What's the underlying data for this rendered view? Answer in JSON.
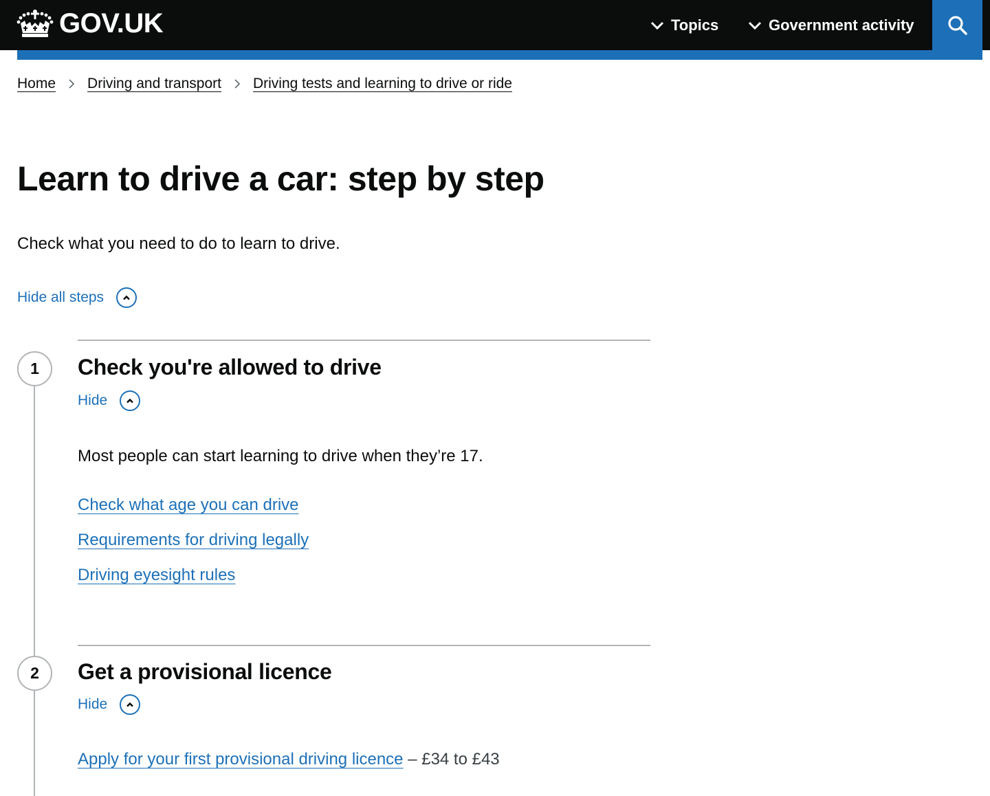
{
  "header": {
    "logo_text": "GOV.UK",
    "nav": [
      {
        "label": "Topics"
      },
      {
        "label": "Government activity"
      }
    ],
    "search_icon": "search-icon"
  },
  "colors": {
    "header_bg": "#0b0c0c",
    "brand_blue": "#1d70b8",
    "text": "#0b0c0c",
    "border": "#b1b4b6"
  },
  "breadcrumb": [
    {
      "label": "Home"
    },
    {
      "label": "Driving and transport"
    },
    {
      "label": "Driving tests and learning to drive or ride"
    }
  ],
  "page": {
    "title": "Learn to drive a car: step by step",
    "lede": "Check what you need to do to learn to drive.",
    "hide_all_label": "Hide all steps"
  },
  "steps": [
    {
      "number": "1",
      "title": "Check you're allowed to drive",
      "toggle_label": "Hide",
      "text": "Most people can start learning to drive when they’re 17.",
      "links": [
        {
          "label": "Check what age you can drive"
        },
        {
          "label": "Requirements for driving legally"
        },
        {
          "label": "Driving eyesight rules"
        }
      ]
    },
    {
      "number": "2",
      "title": "Get a provisional licence",
      "toggle_label": "Hide",
      "links": [
        {
          "label": "Apply for your first provisional driving licence",
          "suffix": " – £34 to £43"
        }
      ]
    }
  ]
}
